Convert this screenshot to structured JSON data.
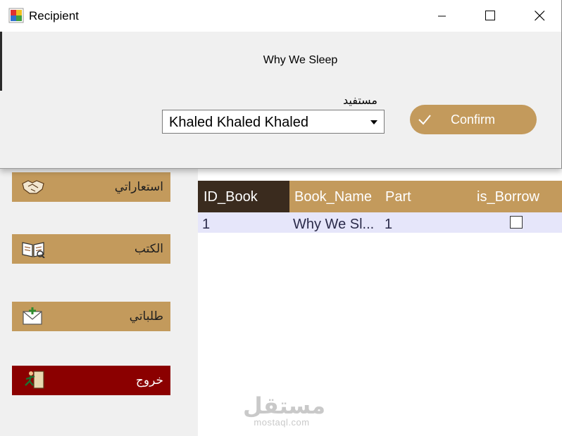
{
  "dialog": {
    "title": "Recipient",
    "book_title": "Why We Sleep",
    "recipient_label": "مستفيد",
    "recipient_value": "Khaled Khaled Khaled",
    "confirm_label": "Confirm",
    "controls": [
      "minimize-icon",
      "maximize-icon",
      "close-icon"
    ]
  },
  "sidebar": {
    "items": [
      {
        "label": "استعاراتي",
        "icon": "handshake-icon"
      },
      {
        "label": "الكتب",
        "icon": "open-book-icon"
      },
      {
        "label": "طلباتي",
        "icon": "mail-add-icon"
      },
      {
        "label": "خروج",
        "icon": "exit-door-icon"
      }
    ],
    "accent": "#c39a5c",
    "exit_color": "#8b0000"
  },
  "grid": {
    "columns": [
      "ID_Book",
      "Book_Name",
      "Part",
      "is_Borrow"
    ],
    "rows": [
      {
        "id": "1",
        "name": "Why We Sl...",
        "part": "1",
        "borrowed": false
      }
    ],
    "header_color": "#c39a5c",
    "selected_header_color": "#3a2b1e",
    "row_color": "#e6e6fa"
  },
  "watermark": {
    "name": "مستقل",
    "url": "mostaql.com"
  }
}
